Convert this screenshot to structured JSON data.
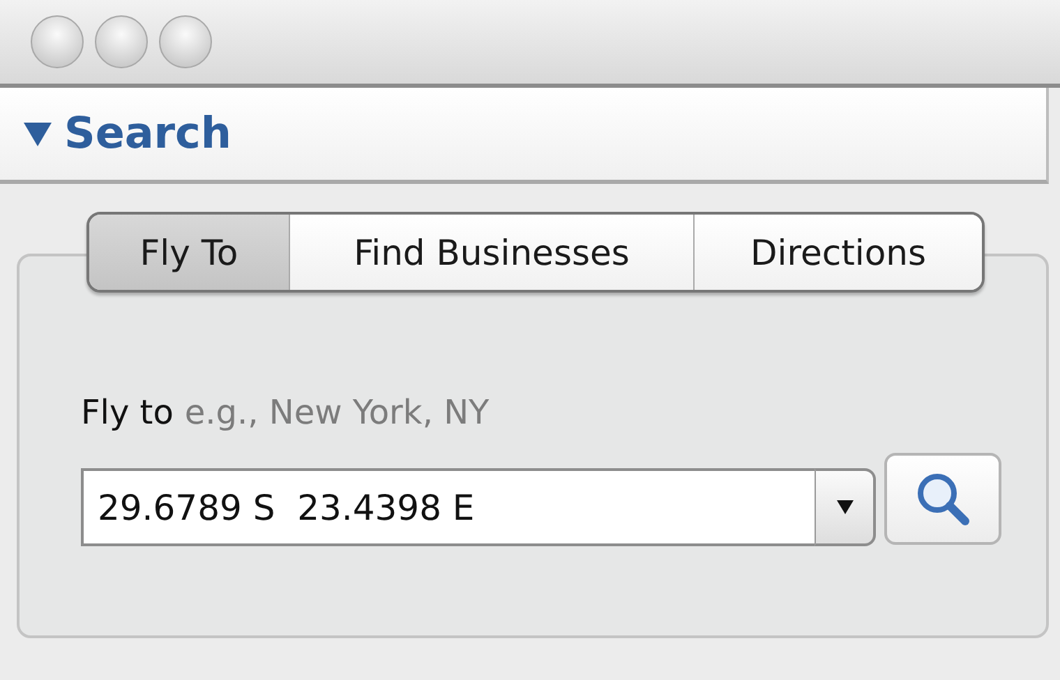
{
  "section": {
    "title": "Search",
    "expanded": true
  },
  "tabs": [
    {
      "label": "Fly To",
      "selected": true
    },
    {
      "label": "Find Businesses",
      "selected": false
    },
    {
      "label": "Directions",
      "selected": false
    }
  ],
  "fly_to": {
    "label": "Fly to",
    "hint": "e.g., New York, NY",
    "value": "29.6789 S  23.4398 E"
  }
}
